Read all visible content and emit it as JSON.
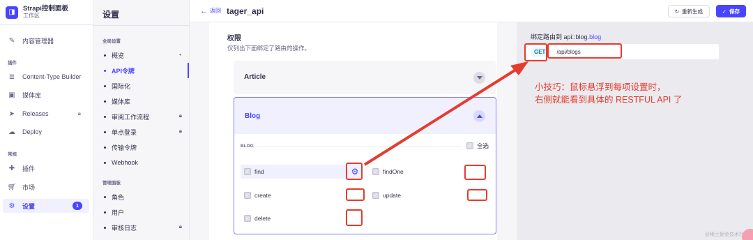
{
  "brand": {
    "title": "Strapi控制面板",
    "subtitle": "工作区",
    "logo_glyph": "◨"
  },
  "nav": {
    "content_manager": "内容管理器",
    "group_plugins": "插件",
    "content_type_builder": "Content-Type Builder",
    "media_library": "媒体库",
    "releases": "Releases",
    "deploy": "Deploy",
    "group_general": "常规",
    "plugins": "插件",
    "marketplace": "市场",
    "settings": "设置",
    "settings_badge": "1"
  },
  "subnav": {
    "title": "设置",
    "group_global": "全局设置",
    "items_global": [
      "概览",
      "API令牌",
      "国际化",
      "媒体库",
      "审阅工作流程",
      "单点登录",
      "传输令牌",
      "Webhook"
    ],
    "group_admin": "管理面板",
    "items_admin": [
      "角色",
      "用户",
      "审核日志"
    ]
  },
  "header": {
    "back_label": "返回",
    "title": "tager_api",
    "regenerate_label": "重新生成",
    "save_label": "保存"
  },
  "permissions": {
    "title": "权限",
    "description": "仅列出下面绑定了路由的操作。",
    "article_label": "Article",
    "blog_label": "Blog",
    "blog_section": "BLOG",
    "select_all": "全选",
    "actions": [
      "find",
      "findOne",
      "create",
      "update",
      "delete"
    ]
  },
  "route": {
    "title_prefix": "绑定路由到",
    "title_api": "api::blog.",
    "title_blog": "blog",
    "method": "GET",
    "path": "/api/blogs"
  },
  "annotation": {
    "line1": "小技巧：鼠标悬浮到每项设置时，",
    "line2": "右侧就能看到具体的 RESTFUL API 了"
  },
  "watermark": "@稀土掘金技术社区",
  "colors": {
    "accent": "#4945ff",
    "annotation": "#e53c2e"
  }
}
